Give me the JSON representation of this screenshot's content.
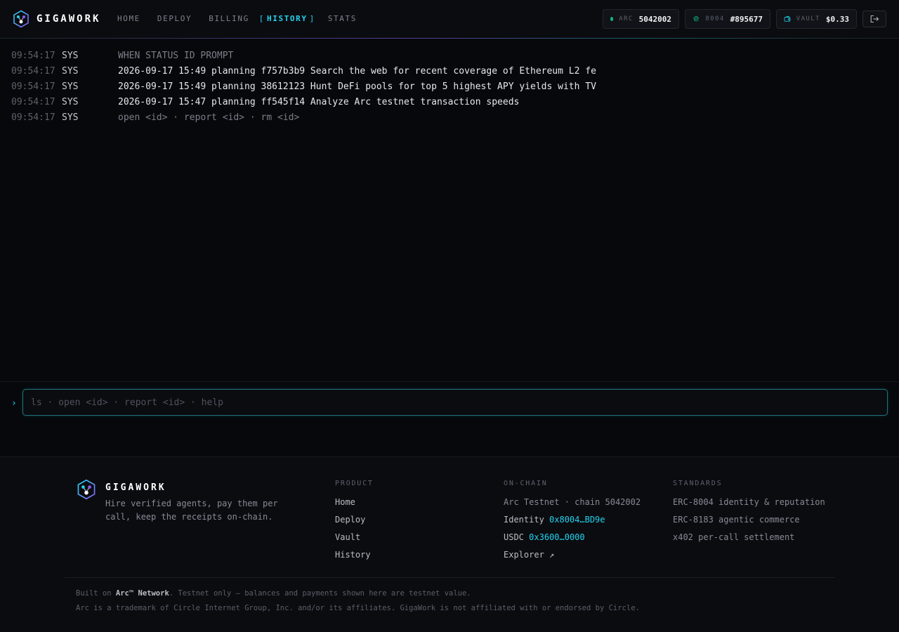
{
  "app": {
    "brand": "GIGAWORK"
  },
  "nav": {
    "items": [
      {
        "label": "HOME"
      },
      {
        "label": "DEPLOY"
      },
      {
        "label": "BILLING"
      }
    ],
    "active": {
      "label": "HISTORY"
    },
    "after": [
      {
        "label": "STATS"
      }
    ],
    "bracket_left": "[",
    "bracket_right": "]"
  },
  "status": {
    "arc": {
      "label": "ARC",
      "value": "5042002",
      "indicator_color": "#10b981"
    },
    "identity": {
      "label": "8004",
      "value": "#895677",
      "icon": "fingerprint-icon"
    },
    "vault": {
      "label": "VAULT",
      "value": "$0.33",
      "icon": "wallet-icon"
    },
    "logout_icon": "logout-icon"
  },
  "log": {
    "rows": [
      {
        "time": "09:54:17",
        "source": "SYS",
        "message": "WHEN STATUS ID PROMPT"
      },
      {
        "time": "09:54:17",
        "source": "SYS",
        "message": "2026-09-17 15:49 planning f757b3b9 Search the web for recent coverage of Ethereum L2 fe"
      },
      {
        "time": "09:54:17",
        "source": "SYS",
        "message": "2026-09-17 15:49 planning 38612123 Hunt DeFi pools for top 5 highest APY yields with TV"
      },
      {
        "time": "09:54:17",
        "source": "SYS",
        "message": "2026-09-17 15:47 planning ff545f14 Analyze Arc testnet transaction speeds"
      },
      {
        "time": "09:54:17",
        "source": "SYS",
        "message": "open <id> · report <id> · rm <id>"
      }
    ]
  },
  "prompt": {
    "caret": "›",
    "placeholder": "ls · open <id> · report <id> · help",
    "value": ""
  },
  "footer": {
    "brand": "GIGAWORK",
    "tagline": "Hire verified agents, pay them per call, keep the receipts on-chain.",
    "product": {
      "title": "PRODUCT",
      "links": [
        "Home",
        "Deploy",
        "Vault",
        "History"
      ]
    },
    "onchain": {
      "title": "ON-CHAIN",
      "network": "Arc Testnet · chain 5042002",
      "identity_label": "Identity",
      "identity_value": "0x8004…BD9e",
      "usdc_label": "USDC",
      "usdc_value": "0x3600…0000",
      "explorer": "Explorer ↗"
    },
    "standards": {
      "title": "STANDARDS",
      "items": [
        "ERC-8004 identity & reputation",
        "ERC-8183 agentic commerce",
        "x402 per-call settlement"
      ]
    },
    "legal": {
      "built_prefix": "Built on",
      "built_network": "Arc™ Network",
      "built_suffix": ". Testnet only — balances and payments shown here are testnet value.",
      "trademark": "Arc is a trademark of Circle Internet Group, Inc. and/or its affiliates. GigaWork is not affiliated with or endorsed by Circle."
    }
  },
  "colors": {
    "accent": "#22d3ee",
    "accent_secondary": "#8b5cf6",
    "background": "#07080b",
    "success": "#10b981"
  }
}
